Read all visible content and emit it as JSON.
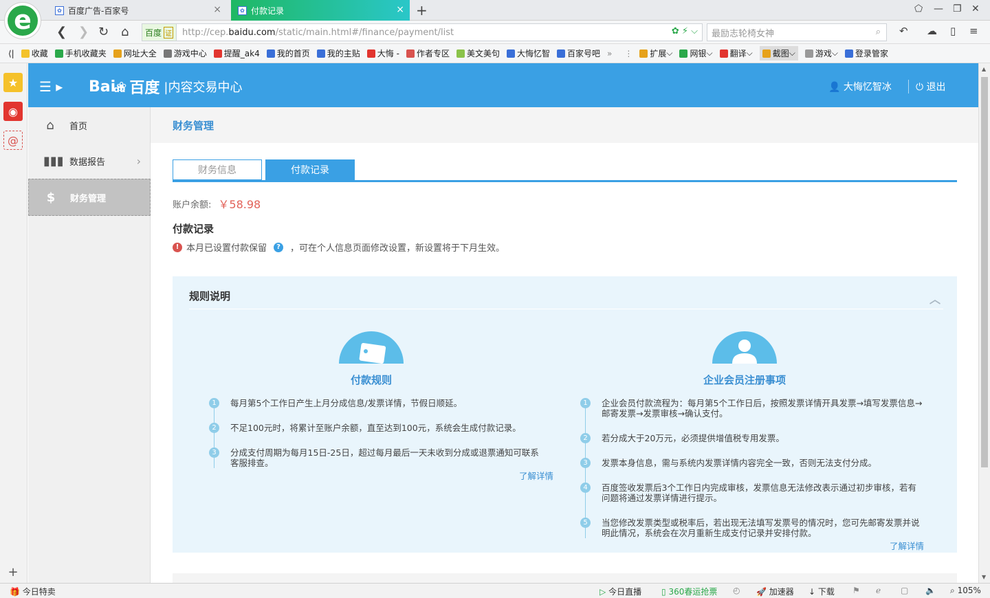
{
  "browser": {
    "tabs": [
      {
        "label": "百度广告-百家号",
        "active": false
      },
      {
        "label": "付款记录",
        "active": true
      }
    ],
    "cert_label": "百度",
    "cert_badge": "证",
    "url_prefix": "http://cep.",
    "url_domain": "baidu.com",
    "url_suffix": "/static/main.html#/finance/payment/list",
    "search_placeholder": "最励志轮椅女神",
    "favorites": [
      {
        "label": "收藏",
        "icon": "star-icon",
        "color": "#f3c22a"
      },
      {
        "label": "手机收藏夹",
        "icon": "phone-icon",
        "color": "#2aa84a"
      },
      {
        "label": "网址大全",
        "icon": "globe-icon",
        "color": "#e6a21b"
      },
      {
        "label": "游戏中心",
        "icon": "gamepad-icon",
        "color": "#777777"
      },
      {
        "label": "提醒_ak4",
        "icon": "weibo-icon",
        "color": "#e2352f"
      },
      {
        "label": "我的首页",
        "icon": "baidu-paw-icon",
        "color": "#3a6fd8"
      },
      {
        "label": "我的主贴",
        "icon": "tieba-icon",
        "color": "#3a6fd8"
      },
      {
        "label": "大悔 -",
        "icon": "diamond-icon",
        "color": "#e2352f"
      },
      {
        "label": "作者专区",
        "icon": "grid-icon",
        "color": "#d9534f"
      },
      {
        "label": "美文美句",
        "icon": "m-icon",
        "color": "#8bc34a"
      },
      {
        "label": "大悔忆智",
        "icon": "baidu-paw-icon",
        "color": "#3a6fd8"
      },
      {
        "label": "百家号吧",
        "icon": "baidu-paw-icon",
        "color": "#3a6fd8"
      }
    ],
    "favorites_more": "»",
    "tools": [
      {
        "label": "扩展"
      },
      {
        "label": "网银"
      },
      {
        "label": "翻译"
      },
      {
        "label": "截图"
      },
      {
        "label": "游戏"
      },
      {
        "label": "登录管家"
      }
    ],
    "status": {
      "left": "今日特卖",
      "live": "今日直播",
      "ticket": "360春运抢票",
      "accelerator": "加速器",
      "download": "下载",
      "zoom": "105%"
    }
  },
  "header": {
    "brand_en": "Bai",
    "brand_du": "du",
    "brand_cn": "百度",
    "brand_sub": "|内容交易中心",
    "username": "大悔忆智冰",
    "logout": "退出"
  },
  "nav": {
    "items": [
      {
        "label": "首页",
        "icon": "home-icon"
      },
      {
        "label": "数据报告",
        "icon": "bar-chart-icon"
      },
      {
        "label": "财务管理",
        "icon": "dollar-icon"
      }
    ]
  },
  "main": {
    "breadcrumb": "财务管理",
    "tabs": [
      {
        "label": "财务信息"
      },
      {
        "label": "付款记录"
      }
    ],
    "balance_label": "账户余额:",
    "balance_value": "￥58.98",
    "section_title": "付款记录",
    "notice_text": "本月已设置付款保留",
    "notice_tail": "，可在个人信息页面修改设置，新设置将于下月生效。",
    "rules": {
      "title": "规则说明",
      "left": {
        "title": "付款规则",
        "steps": [
          "每月第5个工作日产生上月分成信息/发票详情，节假日顺延。",
          "不足100元时，将累计至账户余额，直至达到100元，系统会生成付款记录。",
          "分成支付周期为每月15日-25日，超过每月最后一天未收到分成或退票通知可联系客服排查。"
        ],
        "more": "了解详情"
      },
      "right": {
        "title": "企业会员注册事项",
        "steps": [
          "企业会员付款流程为：每月第5个工作日后，按照发票详情开具发票→填写发票信息→邮寄发票→发票审核→确认支付。",
          "若分成大于20万元，必须提供增值税专用发票。",
          "发票本身信息，需与系统内发票详情内容完全一致，否则无法支付分成。",
          "百度签收发票后3个工作日内完成审核，发票信息无法修改表示通过初步审核，若有问题将通过发票详情进行提示。",
          "当您修改发票类型或税率后，若出现无法填写发票号的情况时，您可先邮寄发票并说明此情况，系统会在次月重新生成支付记录并安排付款。"
        ],
        "more": "了解详情"
      }
    }
  }
}
